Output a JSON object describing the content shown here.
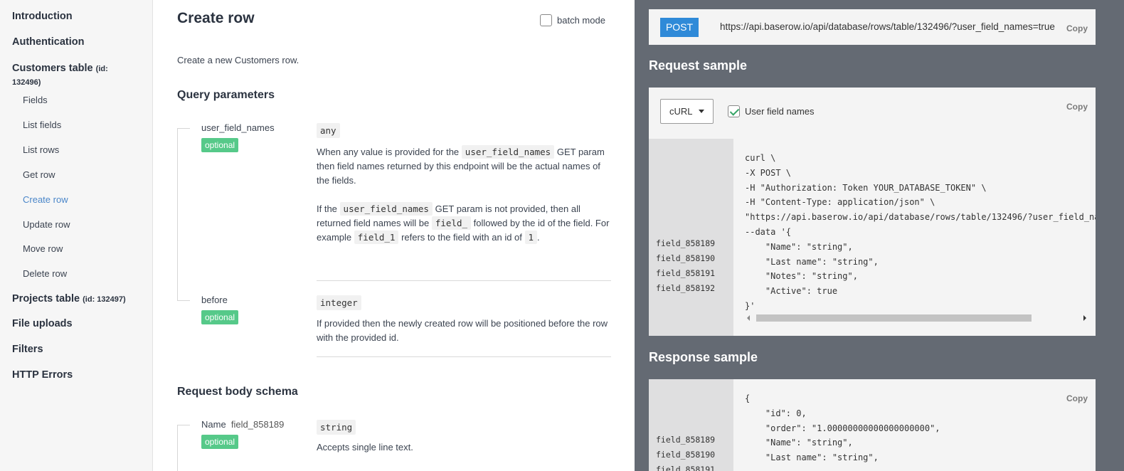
{
  "sidebar": {
    "items": [
      {
        "label": "Introduction"
      },
      {
        "label": "Authentication"
      },
      {
        "label": "Customers table",
        "id_line1": "(id:",
        "id_line2": "132496)"
      },
      {
        "label": "Projects table",
        "id_text": "(id: 132497)"
      },
      {
        "label": "File uploads"
      },
      {
        "label": "Filters"
      },
      {
        "label": "HTTP Errors"
      }
    ],
    "sub_items": [
      "Fields",
      "List fields",
      "List rows",
      "Get row",
      "Create row",
      "Update row",
      "Move row",
      "Delete row"
    ],
    "active_sub": "Create row"
  },
  "main": {
    "title": "Create row",
    "batch_mode_label": "batch mode",
    "description": "Create a new Customers row.",
    "query_params_heading": "Query parameters",
    "params": [
      {
        "name": "user_field_names",
        "badge": "optional",
        "type": "any",
        "p1_a": "When any value is provided for the",
        "p1_code": "user_field_names",
        "p1_b": "GET param then field names returned by this endpoint will be the actual names of the fields.",
        "p2_a": "If the",
        "p2_code": "user_field_names",
        "p2_b": "GET param is not provided, then all returned field names will be",
        "p2_code2": "field_",
        "p2_c": "followed by the id of the field. For example",
        "p2_code3": "field_1",
        "p2_d": "refers to the field with an id of",
        "p2_code4": "1",
        "p2_e": "."
      },
      {
        "name": "before",
        "badge": "optional",
        "type": "integer",
        "text": "If provided then the newly created row will be positioned before the row with the provided id."
      }
    ],
    "body_schema_heading": "Request body schema",
    "body_fields": [
      {
        "name": "Name",
        "field_id": "field_858189",
        "badge": "optional",
        "type": "string",
        "text": "Accepts single line text."
      }
    ]
  },
  "right": {
    "method": "POST",
    "url": "https://api.baserow.io/api/database/rows/table/132496/?user_field_names=true",
    "copy_label": "Copy",
    "request_heading": "Request sample",
    "select_value": "cURL",
    "user_field_names_label": "User field names",
    "request_gutter": [
      "field_858189",
      "field_858190",
      "field_858191",
      "field_858192"
    ],
    "request_code": [
      "curl \\",
      "-X POST \\",
      "-H \"Authorization: Token YOUR_DATABASE_TOKEN\" \\",
      "-H \"Content-Type: application/json\" \\",
      "\"https://api.baserow.io/api/database/rows/table/132496/?user_field_na",
      "--data '{",
      "    \"Name\": \"string\",",
      "    \"Last name\": \"string\",",
      "    \"Notes\": \"string\",",
      "    \"Active\": true",
      "}'"
    ],
    "response_heading": "Response sample",
    "response_gutter": [
      "field_858189",
      "field_858190",
      "field_858191"
    ],
    "response_code": [
      "{",
      "    \"id\": 0,",
      "    \"order\": \"1.00000000000000000000\",",
      "    \"Name\": \"string\",",
      "    \"Last name\": \"string\","
    ]
  }
}
